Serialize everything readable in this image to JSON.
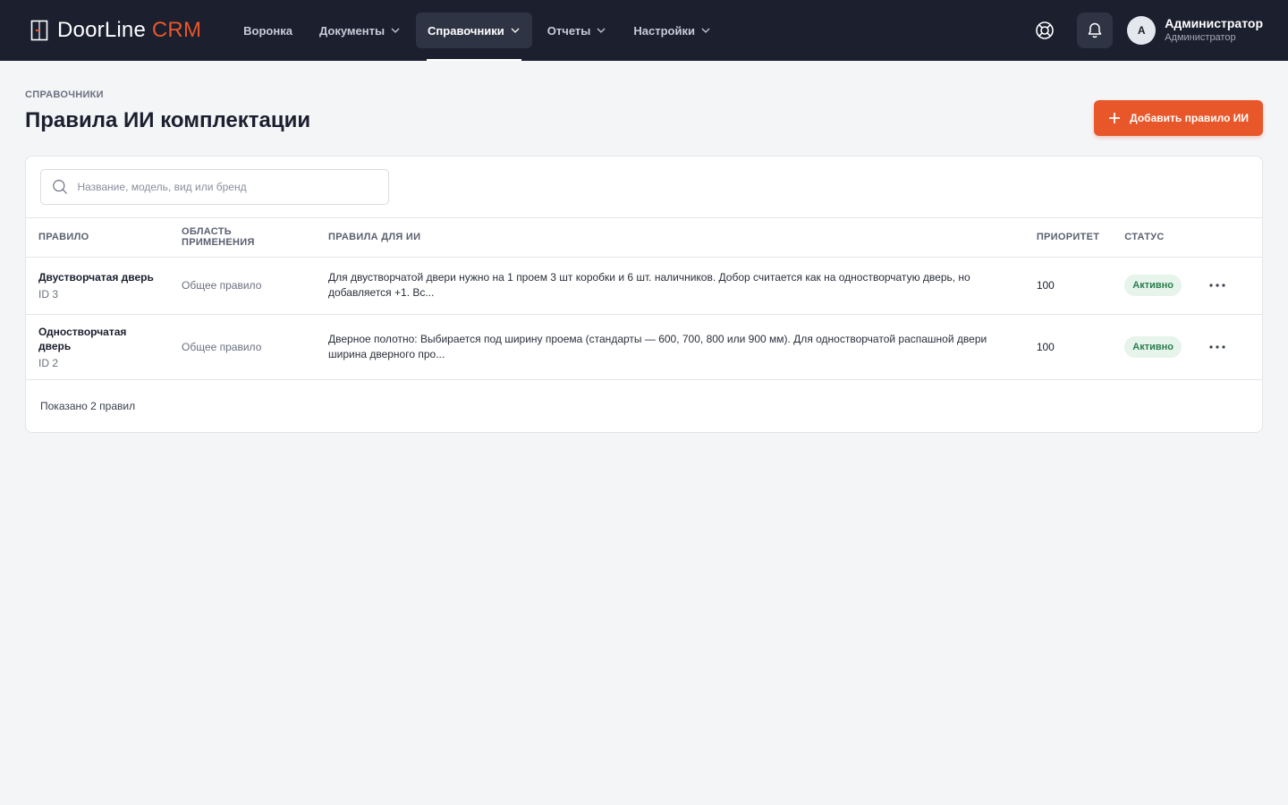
{
  "header": {
    "logo_main": "DoorLine",
    "logo_accent": "CRM",
    "nav": [
      {
        "label": "Воронка",
        "dropdown": false
      },
      {
        "label": "Документы",
        "dropdown": true
      },
      {
        "label": "Справочники",
        "dropdown": true,
        "active": true
      },
      {
        "label": "Отчеты",
        "dropdown": true
      },
      {
        "label": "Настройки",
        "dropdown": true
      }
    ],
    "user": {
      "initial": "А",
      "name": "Администратор",
      "role": "Администратор"
    }
  },
  "page": {
    "breadcrumb": "СПРАВОЧНИКИ",
    "title": "Правила ИИ комплектации",
    "add_button": "Добавить правило ИИ"
  },
  "search": {
    "placeholder": "Название, модель, вид или бренд"
  },
  "table": {
    "columns": [
      "ПРАВИЛО",
      "ОБЛАСТЬ ПРИМЕНЕНИЯ",
      "ПРАВИЛА ДЛЯ ИИ",
      "ПРИОРИТЕТ",
      "СТАТУС"
    ],
    "rows": [
      {
        "name": "Двустворчатая дверь",
        "id": "ID 3",
        "scope": "Общее правило",
        "rules": "Для двустворчатой двери нужно на 1 проем 3 шт коробки и 6 шт. наличников. Добор считается как на одностворчатую дверь, но добавляется +1. Вс...",
        "priority": "100",
        "status": "Активно"
      },
      {
        "name": "Одностворчатая дверь",
        "id": "ID 2",
        "scope": "Общее правило",
        "rules": "Дверное полотно: Выбирается под ширину проема (стандарты — 600, 700, 800 или 900 мм). Для одностворчатой распашной двери ширина дверного про...",
        "priority": "100",
        "status": "Активно"
      }
    ]
  },
  "footer": {
    "count_text": "Показано 2 правил"
  },
  "colors": {
    "accent": "#e8572a",
    "header_bg": "#1b1f2e",
    "status_active": "#2a7d4c"
  }
}
